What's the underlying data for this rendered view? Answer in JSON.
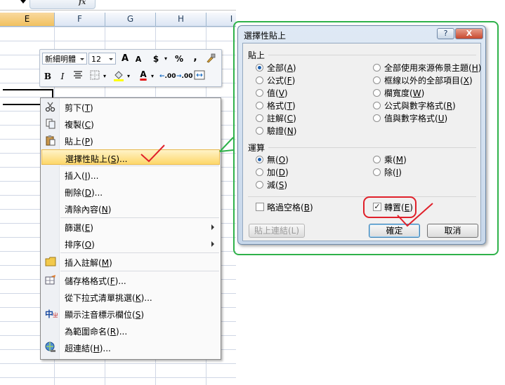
{
  "spreadsheet": {
    "columns": [
      "E",
      "F",
      "G",
      "H",
      "I"
    ],
    "selected_column": "E",
    "formula_label": "fx"
  },
  "mini_toolbar": {
    "font_name": "新細明體",
    "font_size": "12",
    "grow_font": "A",
    "shrink_font": "A",
    "currency": "$",
    "percent": "%",
    "comma": ",",
    "bold": "B",
    "italic": "I",
    "font_color": "A",
    "inc_decimal": ".00",
    "dec_decimal": ".00"
  },
  "context_menu": {
    "items": [
      {
        "label": "剪下",
        "key": "T",
        "icon": "scissors-icon"
      },
      {
        "label": "複製",
        "key": "C",
        "icon": "copy-icon"
      },
      {
        "label": "貼上",
        "key": "P",
        "icon": "paste-icon"
      },
      {
        "label": "選擇性貼上",
        "key": "S",
        "suffix": "...",
        "highlight": true
      },
      {
        "label": "插入",
        "key": "I",
        "suffix": "..."
      },
      {
        "label": "刪除",
        "key": "D",
        "suffix": "..."
      },
      {
        "label": "清除內容",
        "key": "N"
      },
      {
        "label": "篩選",
        "key": "E",
        "submenu": true
      },
      {
        "label": "排序",
        "key": "O",
        "submenu": true
      },
      {
        "label": "插入註解",
        "key": "M",
        "icon": "comment-icon"
      },
      {
        "label": "儲存格格式",
        "key": "F",
        "suffix": "...",
        "icon": "format-cells-icon"
      },
      {
        "label": "從下拉式清單挑選",
        "key": "K",
        "suffix": "..."
      },
      {
        "label": "顯示注音標示欄位",
        "key": "S",
        "icon": "phonetic-icon"
      },
      {
        "label": "為範圍命名",
        "key": "R",
        "suffix": "..."
      },
      {
        "label": "超連結",
        "key": "H",
        "suffix": "...",
        "icon": "hyperlink-icon"
      }
    ]
  },
  "dialog": {
    "title": "選擇性貼上",
    "help": "?",
    "close": "X",
    "paste_section": "貼上",
    "paste_left": [
      {
        "label": "全部",
        "key": "A",
        "checked": true
      },
      {
        "label": "公式",
        "key": "F"
      },
      {
        "label": "值",
        "key": "V"
      },
      {
        "label": "格式",
        "key": "T"
      },
      {
        "label": "註解",
        "key": "C"
      },
      {
        "label": "驗證",
        "key": "N"
      }
    ],
    "paste_right": [
      {
        "label": "全部使用來源佈景主題",
        "key": "H"
      },
      {
        "label": "框線以外的全部項目",
        "key": "X"
      },
      {
        "label": "欄寬度",
        "key": "W"
      },
      {
        "label": "公式與數字格式",
        "key": "R"
      },
      {
        "label": "值與數字格式",
        "key": "U"
      }
    ],
    "op_section": "運算",
    "op_left": [
      {
        "label": "無",
        "key": "O",
        "checked": true
      },
      {
        "label": "加",
        "key": "D"
      },
      {
        "label": "減",
        "key": "S"
      }
    ],
    "op_right": [
      {
        "label": "乘",
        "key": "M"
      },
      {
        "label": "除",
        "key": "I"
      }
    ],
    "skip_blanks": {
      "label": "略過空格",
      "key": "B",
      "checked": false
    },
    "transpose": {
      "label": "轉置",
      "key": "E",
      "checked": true
    },
    "paste_link": "貼上連結(L)",
    "ok": "確定",
    "cancel": "取消"
  },
  "colors": {
    "callout_green": "#2fb24a",
    "annotation_red": "#e0202a",
    "highlight": "#fdd76a"
  }
}
